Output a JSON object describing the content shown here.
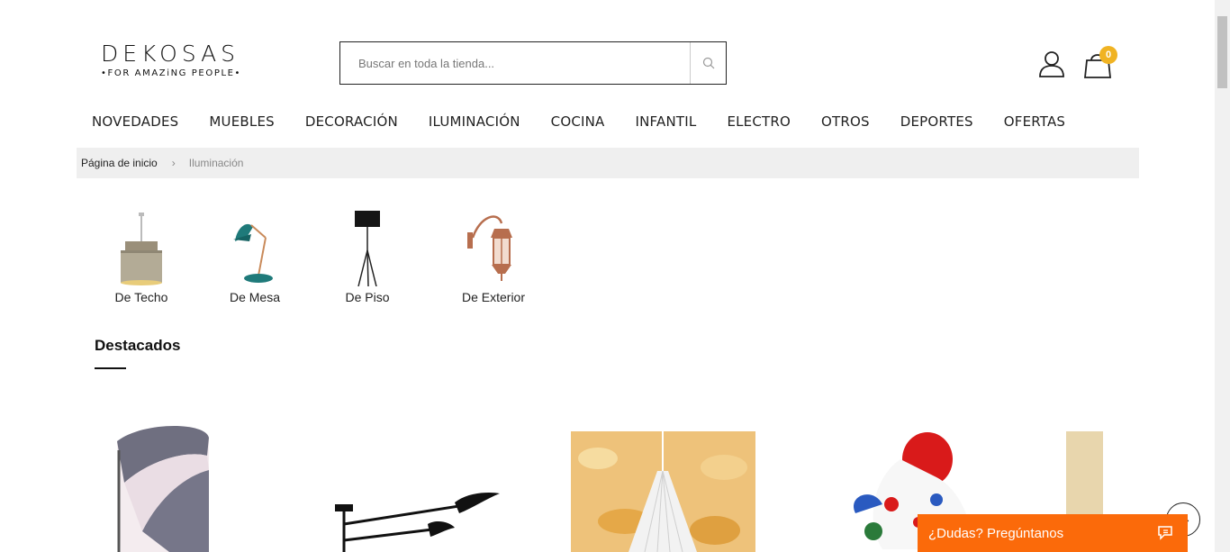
{
  "logo": {
    "main": "DEKOSAS",
    "tagline": "•FOR AMAZiNG PEOPLE•"
  },
  "search": {
    "placeholder": "Buscar en toda la tienda..."
  },
  "cart": {
    "count": "0"
  },
  "nav": {
    "items": [
      "Novedades",
      "Muebles",
      "Decoración",
      "Iluminación",
      "Cocina",
      "Infantil",
      "Electro",
      "Otros",
      "Deportes",
      "Ofertas"
    ]
  },
  "breadcrumb": {
    "home": "Página de inicio",
    "separator": "›",
    "current": "Iluminación"
  },
  "categories": [
    {
      "label": "De Techo",
      "icon": "pendant-lamp-icon"
    },
    {
      "label": "De Mesa",
      "icon": "desk-lamp-icon"
    },
    {
      "label": "De Piso",
      "icon": "floor-lamp-icon"
    },
    {
      "label": "De Exterior",
      "icon": "wall-lantern-icon"
    }
  ],
  "featured": {
    "title": "Destacados"
  },
  "chat": {
    "label": "¿Dudas? Pregúntanos"
  },
  "colors": {
    "accent": "#fb6a0a",
    "badge": "#f0b323",
    "breadcrumb_bg": "#efefef"
  }
}
